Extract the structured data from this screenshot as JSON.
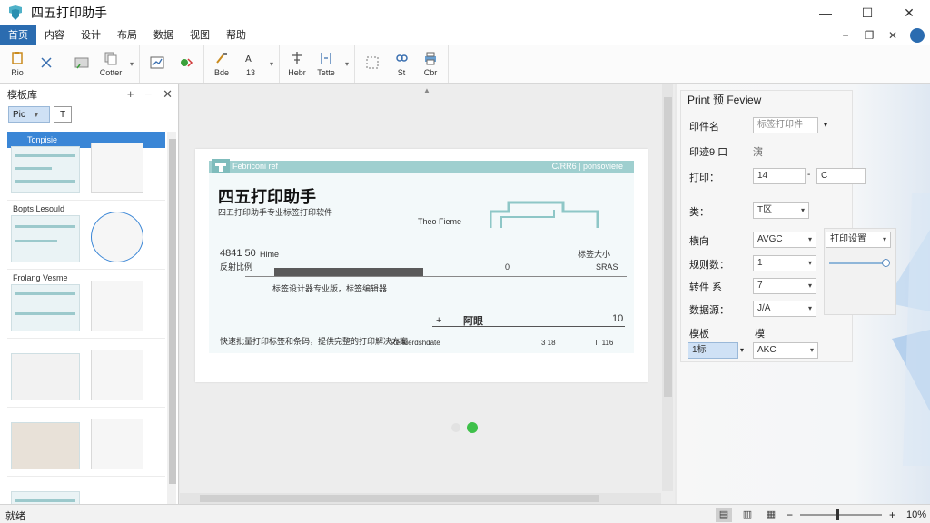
{
  "app": {
    "title": "四五打印助手"
  },
  "window_controls": {
    "minimize": "—",
    "maximize": "☐",
    "close": "✕"
  },
  "menu": [
    "首页",
    "内容",
    "设计",
    "布局",
    "数据",
    "视图",
    "帮助"
  ],
  "doc_controls": {
    "minimize": "−",
    "restore": "❐",
    "close": "✕"
  },
  "ribbon": {
    "groups": [
      {
        "buttons": [
          {
            "label": "Rio",
            "icon": "paste-icon"
          },
          {
            "label": "",
            "icon": "cut-icon"
          }
        ]
      },
      {
        "buttons": [
          {
            "label": "",
            "icon": "text-box-icon"
          },
          {
            "label": "Cotter",
            "icon": "copy-icon"
          }
        ]
      },
      {
        "buttons": [
          {
            "label": "",
            "icon": "chart-icon"
          },
          {
            "label": "",
            "icon": "format-icon"
          }
        ]
      },
      {
        "buttons": [
          {
            "label": "Bde",
            "icon": "brush-icon"
          },
          {
            "label": "13",
            "icon": "font-size-icon"
          }
        ]
      },
      {
        "buttons": [
          {
            "label": "Hebr",
            "icon": "align-icon"
          },
          {
            "label": "Tette",
            "icon": "spacing-icon"
          }
        ]
      },
      {
        "buttons": [
          {
            "label": "",
            "icon": "select-icon"
          },
          {
            "label": "St",
            "icon": "link-icon"
          },
          {
            "label": "Cbr",
            "icon": "print-icon"
          }
        ]
      }
    ]
  },
  "left_panel": {
    "title": "模板库",
    "dropdown": "Pic",
    "filter": "T",
    "templates": [
      {
        "name": "Tonpisie"
      },
      {
        "name": "Bopts Lesould"
      },
      {
        "name": "Frolang Vesme"
      },
      {
        "name": ""
      },
      {
        "name": ""
      },
      {
        "name": ""
      }
    ]
  },
  "label_preview": {
    "band_left": "Febriconi ref",
    "band_right": "C/RR6 | ponsoviere",
    "title": "四五打印助手",
    "subtitle": "四五打印助手专业标签打印软件",
    "tag": "Theo Fieme",
    "left_num": "4841 50",
    "left_num2": "反射比例",
    "left_small": "Hime",
    "mid_zero": "0",
    "right_small1": "标签大小",
    "right_small2": "SRAS",
    "mid_text": "标签设计器专业版，标签编辑器",
    "center_label": "阿眼",
    "right_ten": "10",
    "plus": "+",
    "footer_text": "快速批量打印标签和条码，提供完整的打印解决方案",
    "footer_right1": "Renderdshdate",
    "footer_right2": "3 18",
    "footer_right3": "Ti 116"
  },
  "right_panel": {
    "title": "Print 预 Feview",
    "rows": [
      {
        "label": "印件名",
        "value": "标签打印件"
      },
      {
        "label": "印迹9 口",
        "value": "演"
      },
      {
        "label": "打印：",
        "value": "14",
        "value2": "C"
      },
      {
        "label": "类：",
        "value": "T区"
      },
      {
        "label": "横向",
        "value": "AVGC",
        "extra": "打印设置"
      },
      {
        "label": "规则数：",
        "value": "1"
      },
      {
        "label": "转件 系",
        "value": "7"
      },
      {
        "label": "数据源：",
        "value": "J/A"
      },
      {
        "label": "模板",
        "value": "模"
      },
      {
        "label": "1标",
        "value": "AKC"
      }
    ]
  },
  "status": {
    "left": "就绪",
    "zoom": "10%",
    "zoom_fraction": 0.45
  },
  "colors": {
    "accent": "#2b6cb0",
    "teal": "#9fcfcf",
    "selection": "#3a86d6"
  }
}
